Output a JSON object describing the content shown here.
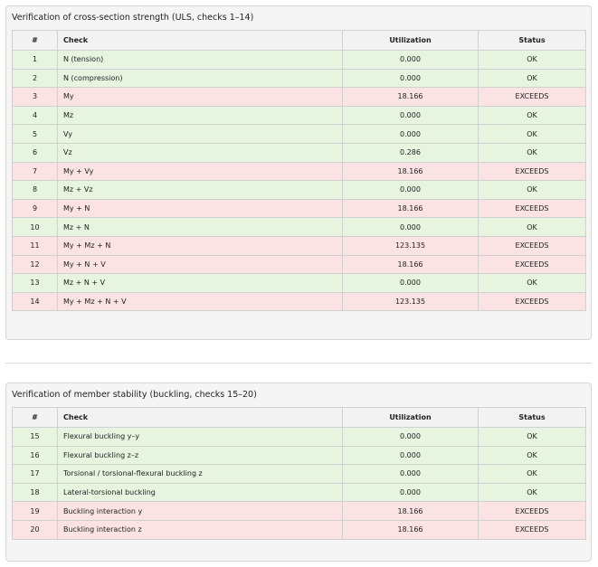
{
  "section1": {
    "title": "Verification of cross-section strength (ULS, checks 1–14)",
    "headers": {
      "num": "#",
      "check": "Check",
      "utilization": "Utilization",
      "status": "Status"
    },
    "rows": [
      {
        "num": "1",
        "check": "N (tension)",
        "utilization": "0.000",
        "status": "OK",
        "state": "ok"
      },
      {
        "num": "2",
        "check": "N (compression)",
        "utilization": "0.000",
        "status": "OK",
        "state": "ok"
      },
      {
        "num": "3",
        "check": "My",
        "utilization": "18.166",
        "status": "EXCEEDS",
        "state": "exceeds"
      },
      {
        "num": "4",
        "check": "Mz",
        "utilization": "0.000",
        "status": "OK",
        "state": "ok"
      },
      {
        "num": "5",
        "check": "Vy",
        "utilization": "0.000",
        "status": "OK",
        "state": "ok"
      },
      {
        "num": "6",
        "check": "Vz",
        "utilization": "0.286",
        "status": "OK",
        "state": "ok"
      },
      {
        "num": "7",
        "check": "My + Vy",
        "utilization": "18.166",
        "status": "EXCEEDS",
        "state": "exceeds"
      },
      {
        "num": "8",
        "check": "Mz + Vz",
        "utilization": "0.000",
        "status": "OK",
        "state": "ok"
      },
      {
        "num": "9",
        "check": "My + N",
        "utilization": "18.166",
        "status": "EXCEEDS",
        "state": "exceeds"
      },
      {
        "num": "10",
        "check": "Mz + N",
        "utilization": "0.000",
        "status": "OK",
        "state": "ok"
      },
      {
        "num": "11",
        "check": "My + Mz + N",
        "utilization": "123.135",
        "status": "EXCEEDS",
        "state": "exceeds"
      },
      {
        "num": "12",
        "check": "My + N + V",
        "utilization": "18.166",
        "status": "EXCEEDS",
        "state": "exceeds"
      },
      {
        "num": "13",
        "check": "Mz + N + V",
        "utilization": "0.000",
        "status": "OK",
        "state": "ok"
      },
      {
        "num": "14",
        "check": "My + Mz + N + V",
        "utilization": "123.135",
        "status": "EXCEEDS",
        "state": "exceeds"
      }
    ]
  },
  "section2": {
    "title": "Verification of member stability (buckling, checks 15–20)",
    "headers": {
      "num": "#",
      "check": "Check",
      "utilization": "Utilization",
      "status": "Status"
    },
    "rows": [
      {
        "num": "15",
        "check": "Flexural buckling y–y",
        "utilization": "0.000",
        "status": "OK",
        "state": "ok"
      },
      {
        "num": "16",
        "check": "Flexural buckling z–z",
        "utilization": "0.000",
        "status": "OK",
        "state": "ok"
      },
      {
        "num": "17",
        "check": "Torsional / torsional-flexural buckling z",
        "utilization": "0.000",
        "status": "OK",
        "state": "ok"
      },
      {
        "num": "18",
        "check": "Lateral-torsional buckling",
        "utilization": "0.000",
        "status": "OK",
        "state": "ok"
      },
      {
        "num": "19",
        "check": "Buckling interaction y",
        "utilization": "18.166",
        "status": "EXCEEDS",
        "state": "exceeds"
      },
      {
        "num": "20",
        "check": "Buckling interaction z",
        "utilization": "18.166",
        "status": "EXCEEDS",
        "state": "exceeds"
      }
    ]
  },
  "colors": {
    "ok_row": "#e6f4e0",
    "exceeds_row": "#fbe3e3",
    "header_row": "#f2f2f2",
    "panel_bg": "#f5f5f5"
  }
}
